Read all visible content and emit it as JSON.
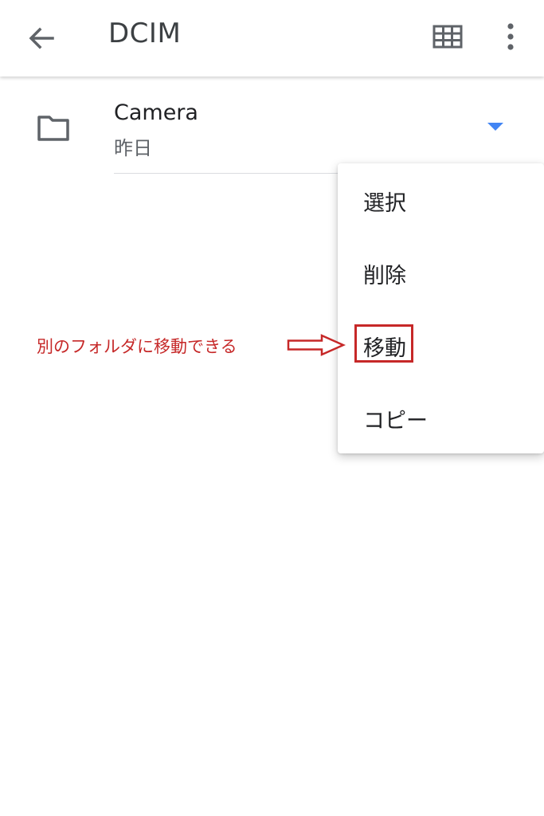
{
  "appbar": {
    "title": "DCIM",
    "icons": {
      "back": "arrow-back-icon",
      "grid": "grid-view-icon",
      "more": "more-vert-icon"
    }
  },
  "folder": {
    "name": "Camera",
    "date": "昨日",
    "icon": "folder-icon"
  },
  "menu": {
    "items": [
      {
        "label": "選択"
      },
      {
        "label": "削除"
      },
      {
        "label": "移動"
      },
      {
        "label": "コピー"
      }
    ]
  },
  "annotation": {
    "text": "別のフォルダに移動できる",
    "color": "#c62828"
  },
  "colors": {
    "icon_gray": "#5f6368",
    "accent_blue": "#4285f4"
  }
}
